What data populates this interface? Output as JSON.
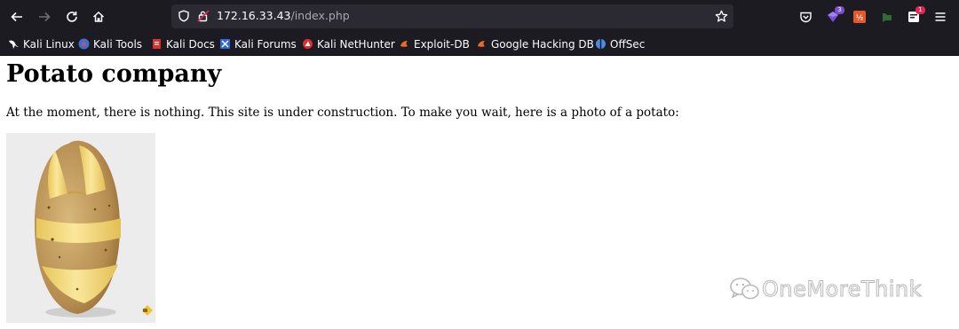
{
  "browser": {
    "url_host": "172.16.33.43",
    "url_path": "/index.php",
    "extensions": {
      "extension_3_badge": "3",
      "notifications_badge": "1"
    },
    "bookmarks": [
      {
        "label": "Kali Linux",
        "icon": "kali-dragon-icon"
      },
      {
        "label": "Kali Tools",
        "icon": "kali-tools-icon"
      },
      {
        "label": "Kali Docs",
        "icon": "kali-docs-icon"
      },
      {
        "label": "Kali Forums",
        "icon": "kali-forums-icon"
      },
      {
        "label": "Kali NetHunter",
        "icon": "nethunter-icon"
      },
      {
        "label": "Exploit-DB",
        "icon": "exploit-db-icon"
      },
      {
        "label": "Google Hacking DB",
        "icon": "ghdb-icon"
      },
      {
        "label": "OffSec",
        "icon": "offsec-icon"
      }
    ]
  },
  "page": {
    "title": "Potato company",
    "text": "At the moment, there is nothing. This site is under construction. To make you wait, here is a photo of a potato:",
    "image": "potato-photo"
  },
  "watermark": {
    "text": "OneMoreThink"
  },
  "colors": {
    "chrome_bg": "#1c1b22",
    "urlbar_bg": "#2b2a33",
    "text_light": "#fbfbfe",
    "potato_yellow": "#f1d98a"
  }
}
